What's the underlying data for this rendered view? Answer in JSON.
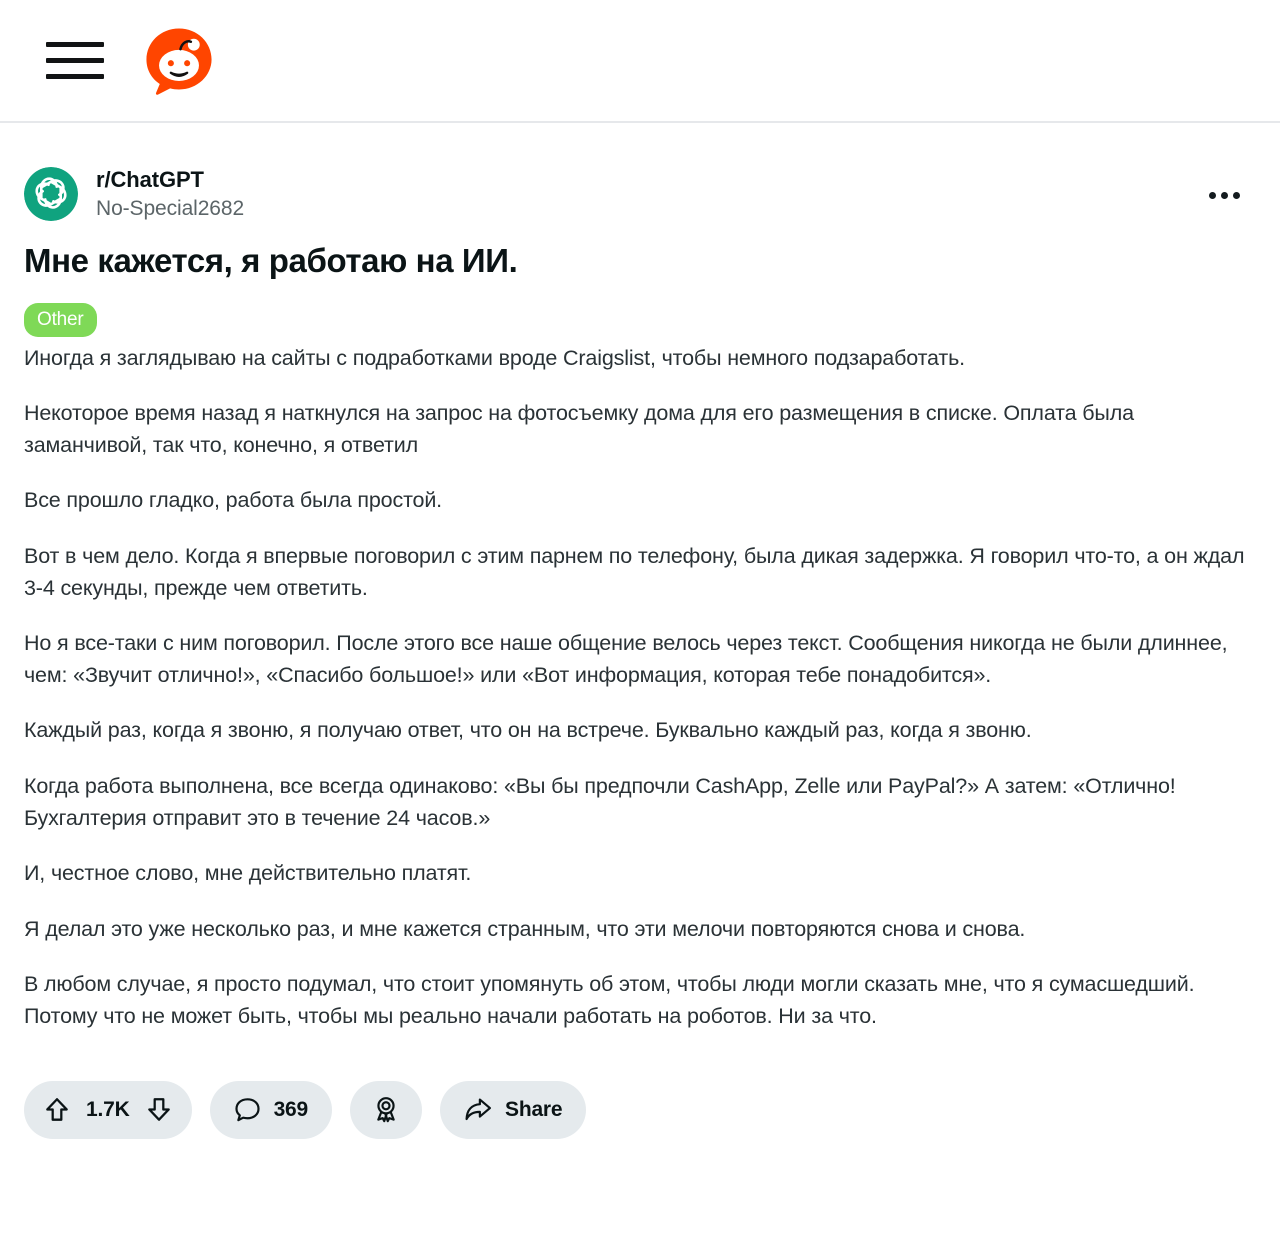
{
  "appbar": {
    "menu_label": "menu",
    "logo_label": "Reddit"
  },
  "post": {
    "subreddit": "r/ChatGPT",
    "author": "No-Special2682",
    "title": "Мне кажется, я работаю на ИИ.",
    "flair": "Other",
    "overflow_label": "More options",
    "avatar_brand_color": "#10a37f",
    "flair_color": "#7fd957",
    "paragraphs": [
      "Иногда я заглядываю на сайты с подработками вроде Craigslist, чтобы немного подзаработать.",
      "Некоторое время назад я наткнулся на запрос на фотосъемку дома для его размещения в списке. Оплата была заманчивой, так что, конечно, я ответил",
      "Все прошло гладко, работа была простой.",
      "Вот в чем дело. Когда я впервые поговорил с этим парнем по телефону, была дикая задержка. Я говорил что-то, а он ждал 3-4 секунды, прежде чем ответить.",
      "Но я все-таки с ним поговорил. После этого все наше общение велось через текст. Сообщения никогда не были длиннее, чем: «Звучит отлично!», «Спасибо большое!» или «Вот информация, которая тебе понадобится».",
      "Каждый раз, когда я звоню, я получаю ответ, что он на встрече. Буквально каждый раз, когда я звоню.",
      "Когда работа выполнена, все всегда одинаково: «Вы бы предпочли CashApp, Zelle или PayPal?» А затем: «Отлично! Бухгалтерия отправит это в течение 24 часов.»",
      "И, честное слово, мне действительно платят.",
      "Я делал это уже несколько раз, и мне кажется странным, что эти мелочи повторяются снова и снова.",
      "В любом случае, я просто подумал, что стоит упомянуть об этом, чтобы люди могли сказать мне, что я сумасшедший. Потому что не может быть, чтобы мы реально начали работать на роботов. Ни за что."
    ]
  },
  "actions": {
    "upvote_count": "1.7K",
    "comment_count": "369",
    "share_label": "Share",
    "upvote_label": "Upvote",
    "downvote_label": "Downvote",
    "award_label": "Award",
    "pill_color": "#e5eaed"
  }
}
